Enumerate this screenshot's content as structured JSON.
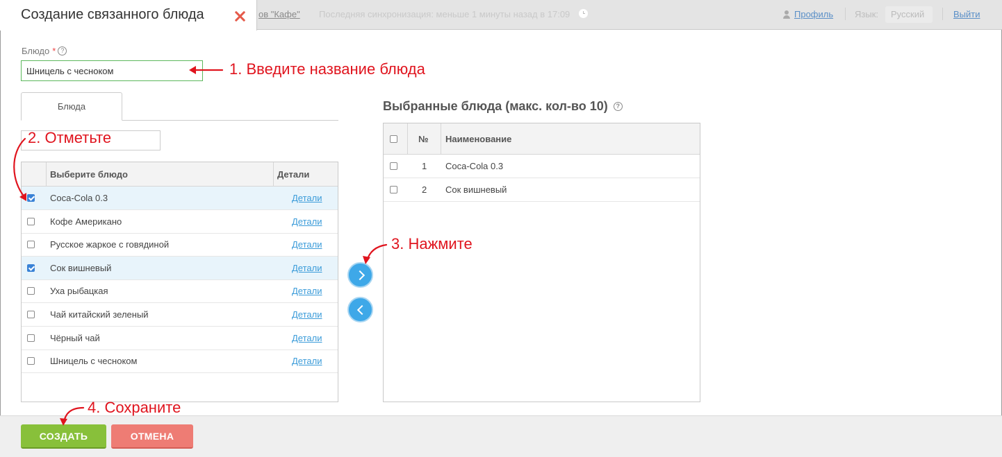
{
  "topbar": {
    "cafe_link": "ов \"Кафе\"",
    "sync_text": "Последняя синхронизация: меньше 1 минуты назад в 17:09",
    "profile": "Профиль",
    "lang_label": "Язык:",
    "lang_value": "Русский",
    "logout": "Выйти"
  },
  "dialog": {
    "title": "Создание связанного блюда",
    "field_label": "Блюдо",
    "required_mark": "*",
    "help": "?",
    "name_value": "Шницель с чесноком",
    "tab_label": "Блюда"
  },
  "left_table": {
    "columns": {
      "name": "Выберите блюдо",
      "details": "Детали"
    },
    "rows": [
      {
        "name": "Coca-Cola 0.3",
        "details": "Детали",
        "checked": true
      },
      {
        "name": "Кофе Американо",
        "details": "Детали",
        "checked": false
      },
      {
        "name": "Русское жаркое с говядиной",
        "details": "Детали",
        "checked": false
      },
      {
        "name": "Сок вишневый",
        "details": "Детали",
        "checked": true
      },
      {
        "name": "Уха рыбацкая",
        "details": "Детали",
        "checked": false
      },
      {
        "name": "Чай китайский зеленый",
        "details": "Детали",
        "checked": false
      },
      {
        "name": "Чёрный чай",
        "details": "Детали",
        "checked": false
      },
      {
        "name": "Шницель с чесноком",
        "details": "Детали",
        "checked": false
      }
    ]
  },
  "right_table": {
    "title": "Выбранные блюда (макс. кол-во 10)",
    "columns": {
      "num": "№",
      "name": "Наименование"
    },
    "rows": [
      {
        "num": "1",
        "name": "Coca-Cola 0.3"
      },
      {
        "num": "2",
        "name": "Сок вишневый"
      }
    ]
  },
  "buttons": {
    "create": "СОЗДАТЬ",
    "cancel": "ОТМЕНА"
  },
  "annotations": {
    "step1": "1. Введите название блюда",
    "step2": "2. Отметьте",
    "step3": "3. Нажмите",
    "step4": "4. Сохраните"
  },
  "colors": {
    "annotation": "#e0141e",
    "create": "#88c03a",
    "cancel": "#ee7c74",
    "accent": "#3ea8e8"
  }
}
